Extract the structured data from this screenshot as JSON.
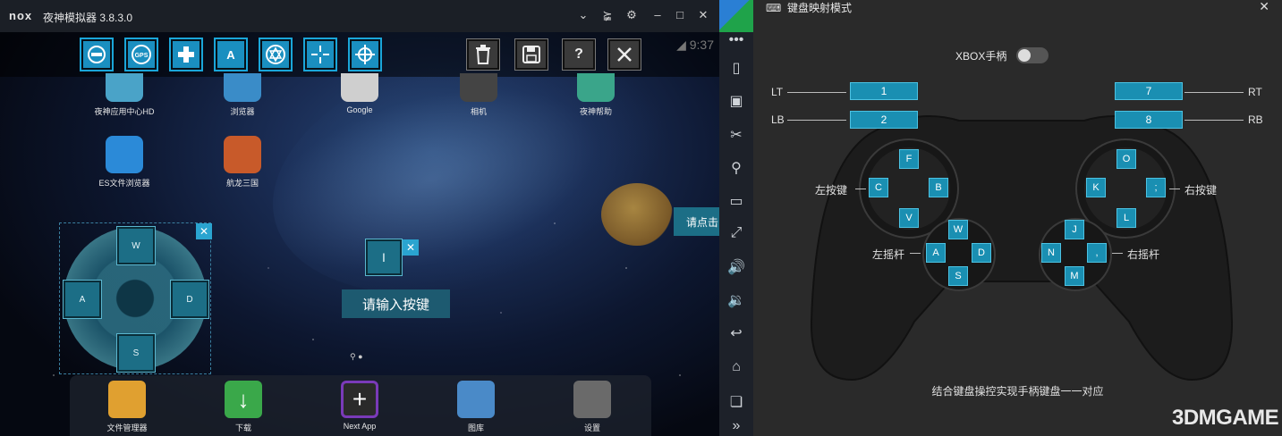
{
  "window": {
    "logo": "nox",
    "title": "夜神模拟器 3.8.3.0"
  },
  "window_controls": [
    "chevron-down",
    "pin",
    "gear",
    "minimize",
    "maximize",
    "close"
  ],
  "status": {
    "time": "9:37"
  },
  "toolbar": {
    "tools": [
      "joystick",
      "gps",
      "dpad",
      "key-a",
      "aim",
      "crosshair",
      "target"
    ],
    "tool_text": {
      "gps": "GPS",
      "key_a": "A"
    },
    "actions": [
      "trash",
      "save",
      "help",
      "close"
    ],
    "help_text": "?"
  },
  "desktop_apps": [
    {
      "label": "夜神应用中心HD",
      "color": "#4aa3c8"
    },
    {
      "label": "浏览器",
      "color": "#3a8cc8"
    },
    {
      "label": "Google",
      "color": "#ddd"
    },
    {
      "label": "相机",
      "color": "#555"
    },
    {
      "label": "夜神帮助",
      "color": "#3aa58a"
    },
    {
      "label": "ES文件浏览器",
      "color": "#2b8ad8"
    },
    {
      "label": "航龙三国",
      "color": "#c85a2a"
    }
  ],
  "dpad": {
    "up": "W",
    "left": "A",
    "right": "D",
    "down": "S"
  },
  "key_prompt": {
    "key": "I",
    "hint": "请输入按键"
  },
  "tap_prompt": "请点击",
  "dock_apps": [
    {
      "label": "文件管理器",
      "color": "#e0a030"
    },
    {
      "label": "下载",
      "color": "#3aa84a"
    },
    {
      "label": "Next App",
      "color": "#7a3ab8"
    },
    {
      "label": "图库",
      "color": "#4a8ac8"
    },
    {
      "label": "设置",
      "color": "#6a6a6a"
    }
  ],
  "sidebar_icons": [
    "more-dots",
    "shake",
    "robot",
    "scissors",
    "location",
    "screen",
    "fullscreen",
    "volume-up",
    "volume-down",
    "back",
    "home",
    "recent",
    "expand"
  ],
  "panel": {
    "title": "键盘映射模式",
    "xbox_label": "XBOX手柄",
    "xbox_enabled": false,
    "bumpers": {
      "LT": "1",
      "LB": "2",
      "RT": "7",
      "RB": "8"
    },
    "bumper_labels": {
      "LT": "LT",
      "LB": "LB",
      "RT": "RT",
      "RB": "RB"
    },
    "left_buttons": {
      "up": "F",
      "left": "C",
      "right": "B",
      "down": "V"
    },
    "left_buttons_label": "左按键",
    "left_stick": {
      "up": "W",
      "left": "A",
      "right": "D",
      "down": "S"
    },
    "left_stick_label": "左摇杆",
    "right_buttons": {
      "up": "O",
      "left": "K",
      "right": ";",
      "down": "L"
    },
    "right_buttons_label": "右按键",
    "right_stick": {
      "up": "J",
      "left": "N",
      "right": ",",
      "down": "M"
    },
    "right_stick_label": "右摇杆",
    "footer": "结合键盘操控实现手柄键盘一一对应"
  },
  "watermark": "3DMGAME",
  "accent": "#1a8fb2"
}
